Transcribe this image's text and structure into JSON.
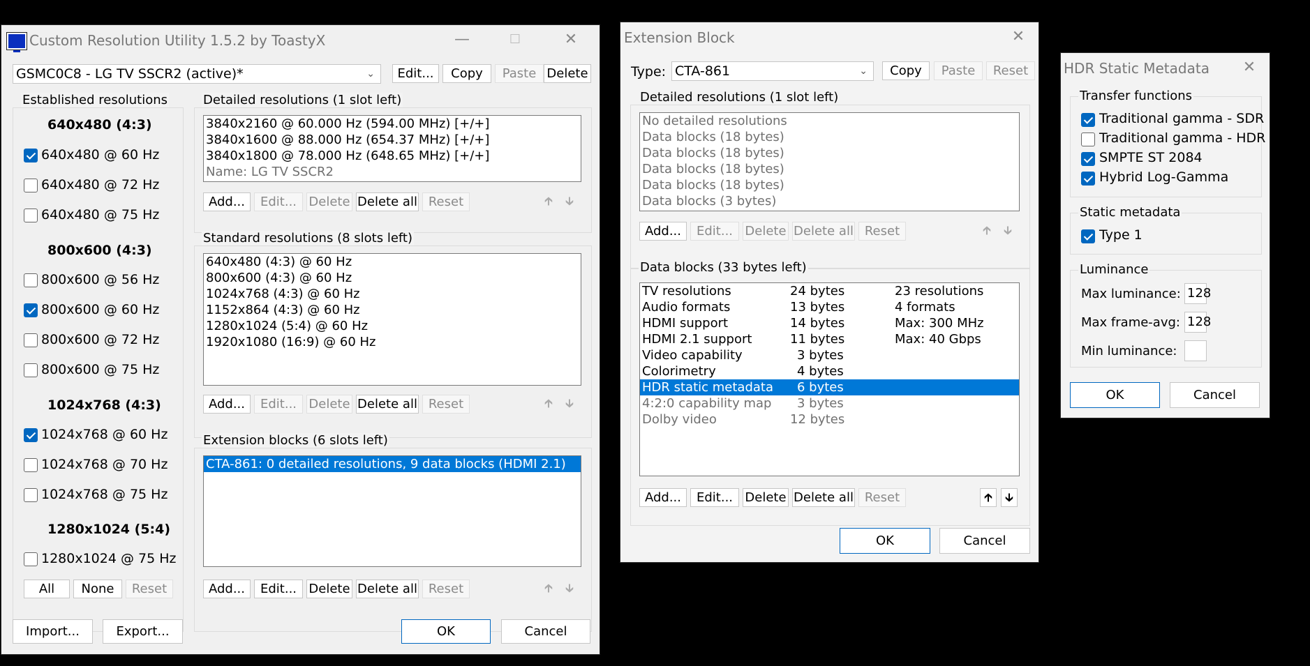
{
  "cru": {
    "title": "Custom Resolution Utility 1.5.2 by ToastyX",
    "monitor": "GSMC0C8 - LG TV SSCR2 (active)*",
    "top_buttons": [
      "Edit...",
      "Copy",
      "Paste",
      "Delete"
    ],
    "established": {
      "label": "Established resolutions",
      "groups": [
        {
          "heading": "640x480 (4:3)",
          "items": [
            {
              "label": "640x480 @ 60 Hz",
              "checked": true
            },
            {
              "label": "640x480 @ 72 Hz",
              "checked": false
            },
            {
              "label": "640x480 @ 75 Hz",
              "checked": false
            }
          ]
        },
        {
          "heading": "800x600 (4:3)",
          "items": [
            {
              "label": "800x600 @ 56 Hz",
              "checked": false
            },
            {
              "label": "800x600 @ 60 Hz",
              "checked": true
            },
            {
              "label": "800x600 @ 72 Hz",
              "checked": false
            },
            {
              "label": "800x600 @ 75 Hz",
              "checked": false
            }
          ]
        },
        {
          "heading": "1024x768 (4:3)",
          "items": [
            {
              "label": "1024x768 @ 60 Hz",
              "checked": true
            },
            {
              "label": "1024x768 @ 70 Hz",
              "checked": false
            },
            {
              "label": "1024x768 @ 75 Hz",
              "checked": false
            }
          ]
        },
        {
          "heading": "1280x1024 (5:4)",
          "items": [
            {
              "label": "1280x1024 @ 75 Hz",
              "checked": false
            }
          ]
        }
      ],
      "buttons": [
        "All",
        "None",
        "Reset"
      ]
    },
    "detailed": {
      "label": "Detailed resolutions (1 slot left)",
      "rows": [
        "3840x2160 @ 60.000 Hz (594.00 MHz) [+/+]",
        "3840x1600 @ 88.000 Hz (654.37 MHz) [+/+]",
        "3840x1800 @ 78.000 Hz (648.65 MHz) [+/+]",
        "Name: LG TV SSCR2"
      ],
      "buttons": [
        "Add...",
        "Edit...",
        "Delete",
        "Delete all",
        "Reset"
      ]
    },
    "standard": {
      "label": "Standard resolutions (8 slots left)",
      "rows": [
        "640x480 (4:3) @ 60 Hz",
        "800x600 (4:3) @ 60 Hz",
        "1024x768 (4:3) @ 60 Hz",
        "1152x864 (4:3) @ 60 Hz",
        "1280x1024 (5:4) @ 60 Hz",
        "1920x1080 (16:9) @ 60 Hz"
      ],
      "buttons": [
        "Add...",
        "Edit...",
        "Delete",
        "Delete all",
        "Reset"
      ]
    },
    "extension": {
      "label": "Extension blocks (6 slots left)",
      "rows": [
        "CTA-861: 0 detailed resolutions, 9 data blocks (HDMI 2.1)"
      ],
      "buttons": [
        "Add...",
        "Edit...",
        "Delete",
        "Delete all",
        "Reset"
      ]
    },
    "bottom_buttons": [
      "Import...",
      "Export...",
      "OK",
      "Cancel"
    ]
  },
  "ext": {
    "title": "Extension Block",
    "type_label": "Type:",
    "type_value": "CTA-861",
    "top_buttons": [
      "Copy",
      "Paste",
      "Reset"
    ],
    "detailed": {
      "label": "Detailed resolutions (1 slot left)",
      "rows": [
        "No detailed resolutions",
        "Data blocks (18 bytes)",
        "Data blocks (18 bytes)",
        "Data blocks (18 bytes)",
        "Data blocks (18 bytes)",
        "Data blocks (3 bytes)"
      ],
      "buttons": [
        "Add...",
        "Edit...",
        "Delete",
        "Delete all",
        "Reset"
      ]
    },
    "datablocks": {
      "label": "Data blocks (33 bytes left)",
      "rows": [
        {
          "name": "TV resolutions",
          "size": "24 bytes",
          "info": "23 resolutions"
        },
        {
          "name": "Audio formats",
          "size": "13 bytes",
          "info": "4 formats"
        },
        {
          "name": "HDMI support",
          "size": "14 bytes",
          "info": "Max: 300 MHz"
        },
        {
          "name": "HDMI 2.1 support",
          "size": "11 bytes",
          "info": "Max: 40 Gbps"
        },
        {
          "name": "Video capability",
          "size": "3 bytes",
          "info": ""
        },
        {
          "name": "Colorimetry",
          "size": "4 bytes",
          "info": ""
        },
        {
          "name": "HDR static metadata",
          "size": "6 bytes",
          "info": ""
        },
        {
          "name": "4:2:0 capability map",
          "size": "3 bytes",
          "info": ""
        },
        {
          "name": "Dolby video",
          "size": "12 bytes",
          "info": ""
        }
      ],
      "buttons": [
        "Add...",
        "Edit...",
        "Delete",
        "Delete all",
        "Reset"
      ]
    },
    "bottom_buttons": [
      "OK",
      "Cancel"
    ]
  },
  "hdr": {
    "title": "HDR Static Metadata",
    "transfer": {
      "label": "Transfer functions",
      "items": [
        {
          "label": "Traditional gamma - SDR",
          "checked": true
        },
        {
          "label": "Traditional gamma - HDR",
          "checked": false
        },
        {
          "label": "SMPTE ST 2084",
          "checked": true
        },
        {
          "label": "Hybrid Log-Gamma",
          "checked": true
        }
      ]
    },
    "static": {
      "label": "Static metadata",
      "items": [
        {
          "label": "Type 1",
          "checked": true
        }
      ]
    },
    "luminance": {
      "label": "Luminance",
      "max_label": "Max luminance:",
      "max_value": "128",
      "frame_label": "Max frame-avg:",
      "frame_value": "128",
      "min_label": "Min luminance:",
      "min_value": ""
    },
    "bottom_buttons": [
      "OK",
      "Cancel"
    ]
  }
}
